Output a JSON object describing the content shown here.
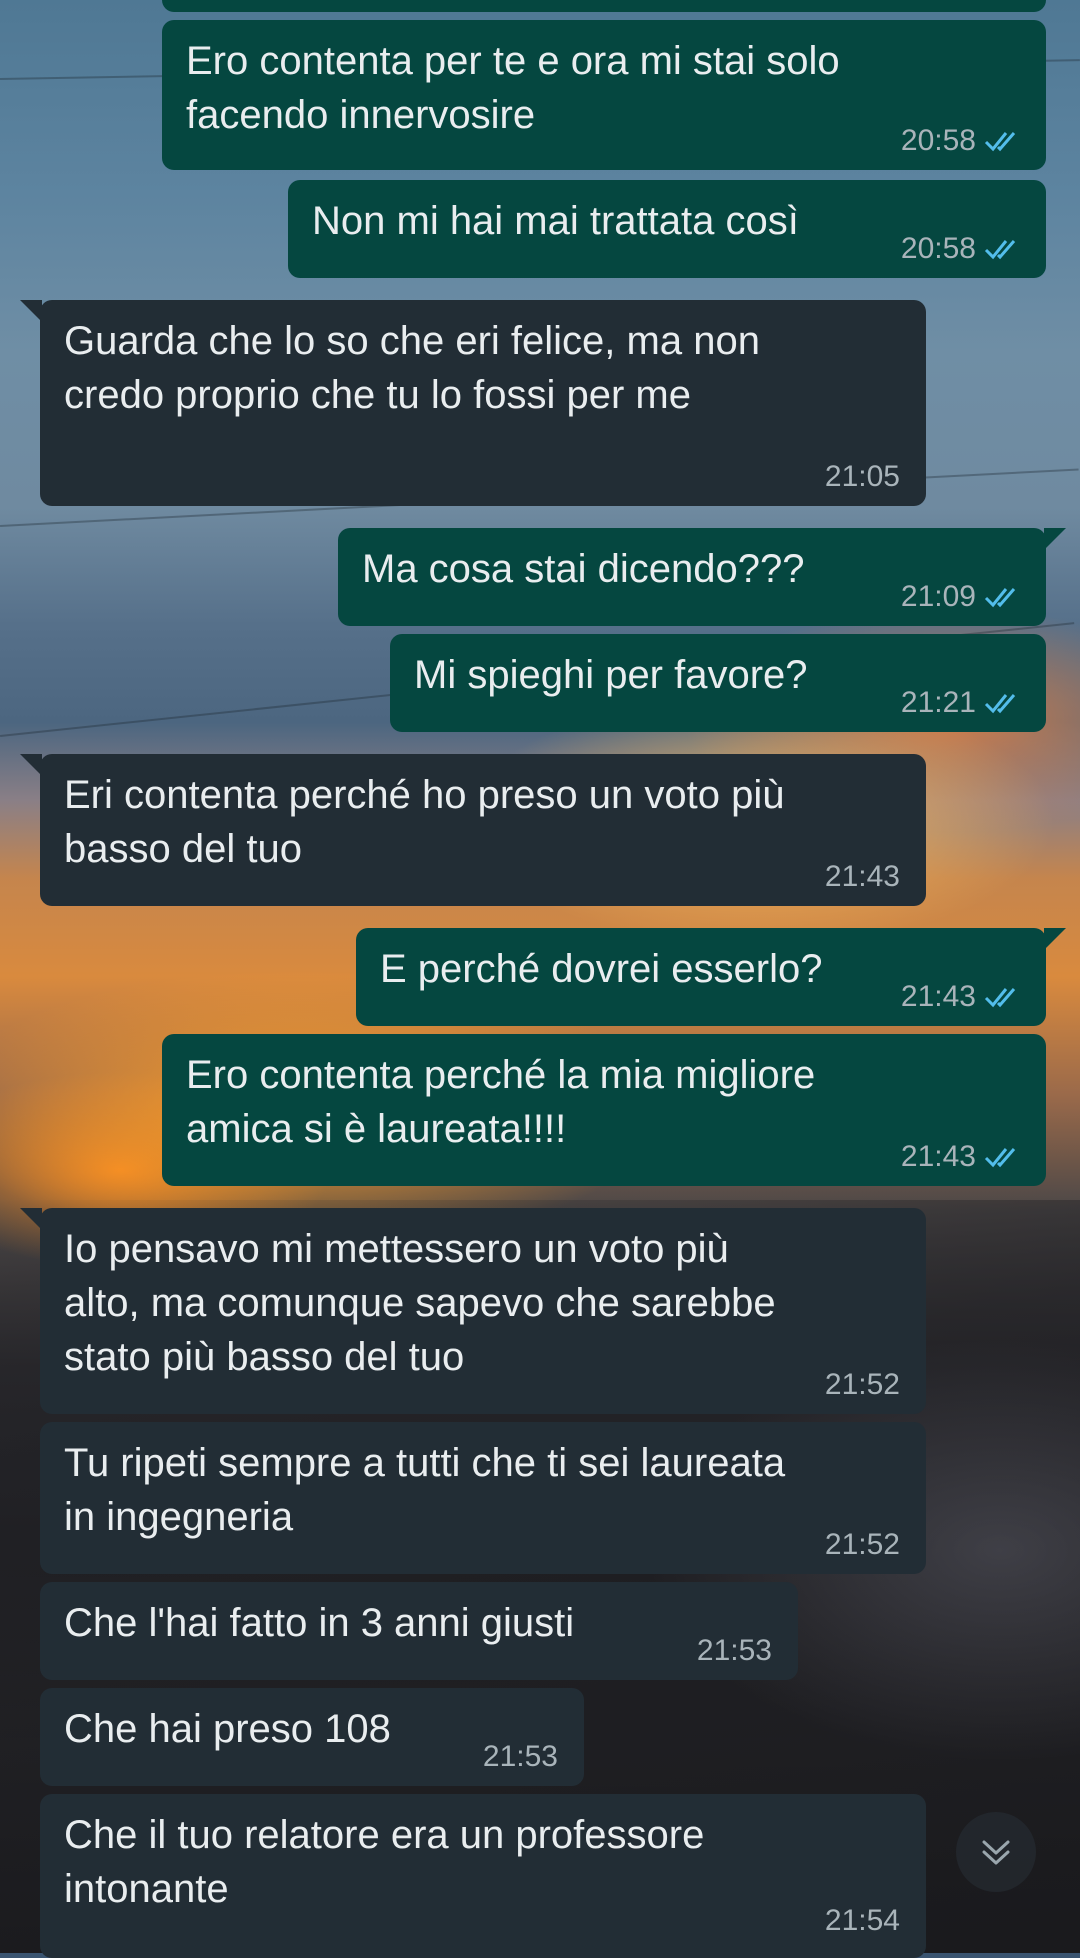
{
  "messages": [
    {
      "dir": "out",
      "text": "",
      "time": ""
    },
    {
      "dir": "out",
      "text": "Ero contenta per te e ora mi stai solo\nfacendo innervosire",
      "time": "20:58",
      "read": true
    },
    {
      "dir": "out",
      "text": "Non mi hai mai trattata così",
      "time": "20:58",
      "read": true
    },
    {
      "dir": "in",
      "text": "Guarda che lo so che eri felice, ma non\ncredo proprio che tu lo fossi per me",
      "time": "21:05"
    },
    {
      "dir": "out",
      "text": "Ma cosa stai dicendo???",
      "time": "21:09",
      "read": true
    },
    {
      "dir": "out",
      "text": "Mi spieghi per favore?",
      "time": "21:21",
      "read": true
    },
    {
      "dir": "in",
      "text": "Eri contenta perché ho preso un voto più\nbasso del tuo",
      "time": "21:43"
    },
    {
      "dir": "out",
      "text": "E perché dovrei esserlo?",
      "time": "21:43",
      "read": true
    },
    {
      "dir": "out",
      "text": "Ero contenta perché la mia migliore\namica si è laureata!!!!",
      "time": "21:43",
      "read": true
    },
    {
      "dir": "in",
      "text": "Io pensavo mi mettessero un voto più\nalto, ma comunque sapevo che sarebbe\nstato più basso del tuo",
      "time": "21:52"
    },
    {
      "dir": "in",
      "text": "Tu ripeti sempre a tutti che ti sei laureata\nin ingegneria",
      "time": "21:52"
    },
    {
      "dir": "in",
      "text": "Che l'hai fatto in 3 anni giusti",
      "time": "21:53"
    },
    {
      "dir": "in",
      "text": "Che hai preso 108",
      "time": "21:53"
    },
    {
      "dir": "in",
      "text": "Che il tuo relatore era un professore\nintonante",
      "time": "21:54"
    }
  ],
  "colors": {
    "outgoing_bubble": "#054740",
    "incoming_bubble": "#222d35",
    "text": "#e9edef",
    "time": "#a9b4ba",
    "read_ticks": "#53bdeb"
  },
  "icons": {
    "scroll_down": "chevron-double-down-icon",
    "read_receipt": "double-check-icon"
  }
}
